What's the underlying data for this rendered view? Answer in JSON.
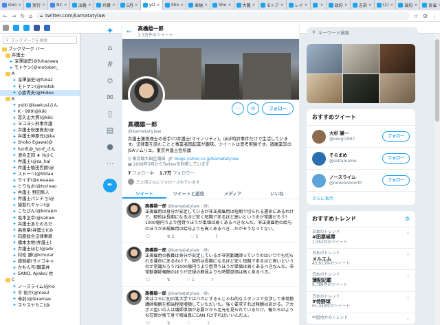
{
  "browser": {
    "tabs": [
      {
        "label": "Goo",
        "color": "#4285f4"
      },
      {
        "label": "実行",
        "color": "#1da1f2"
      },
      {
        "label": "NC",
        "color": "#4285f4"
      },
      {
        "label": "淡路",
        "color": "#1da1f2"
      },
      {
        "label": "弁護",
        "color": "#1da1f2"
      },
      {
        "label": "5月",
        "color": "#1da1f2"
      },
      {
        "label": "yst",
        "color": "#1da1f2"
      },
      {
        "label": "Sho",
        "color": "#1da1f2"
      },
      {
        "label": "奉納",
        "color": "#1da1f2"
      },
      {
        "label": "Sho",
        "color": "#1da1f2"
      },
      {
        "label": "大農",
        "color": "#1da1f2"
      },
      {
        "label": "モトア",
        "color": "#1da1f2"
      },
      {
        "label": "レイ",
        "color": "#1da1f2"
      },
      {
        "label": "",
        "color": "#1da1f2"
      },
      {
        "label": "政府",
        "color": "#1da1f2"
      },
      {
        "label": "吉梁",
        "color": "#1da1f2"
      },
      {
        "label": "(2)",
        "color": "#1da1f2"
      },
      {
        "label": "政府",
        "color": "#1da1f2"
      },
      {
        "label": "反省",
        "color": "#1da1f2"
      }
    ],
    "url": "twitter.com/kamatatylaw"
  },
  "sidebar": {
    "search_placeholder": "ブックマークを検索",
    "items": [
      {
        "label": "ブックマーク バー",
        "type": "folder",
        "indent": 0
      },
      {
        "label": "弁護士",
        "type": "folder",
        "indent": 1
      },
      {
        "label": "深澤諭史(@fukazawa",
        "type": "tw",
        "indent": 2
      },
      {
        "label": "モトケン(@motoken_",
        "type": "tw",
        "indent": 2
      },
      {
        "label": "A",
        "type": "folder",
        "indent": 1
      },
      {
        "label": "深澤諭史(@fukaz",
        "type": "tw",
        "indent": 3
      },
      {
        "label": "モトケン(@motok",
        "type": "tw",
        "indent": 3
      },
      {
        "label": "小倉秀夫(@Hideo",
        "type": "tw",
        "indent": 3,
        "selected": true
      },
      {
        "label": "B",
        "type": "folder",
        "indent": 1
      },
      {
        "label": "ystk(@lawkus)さん",
        "type": "tw",
        "indent": 3
      },
      {
        "label": "K・999(@kiki",
        "type": "tw",
        "indent": 3
      },
      {
        "label": "首久山大費(@kiki",
        "type": "tw",
        "indent": 3
      },
      {
        "label": "ヨコヨシ刑事弁護",
        "type": "tw",
        "indent": 3
      },
      {
        "label": "弁護士秋田真志(@",
        "type": "tw",
        "indent": 3
      },
      {
        "label": "弁護士神原元(@ka",
        "type": "tw",
        "indent": 3
      },
      {
        "label": "Shoko Egawa(@",
        "type": "tw",
        "indent": 3
      },
      {
        "label": "hznf(@_hznf_さん",
        "type": "tw",
        "indent": 3
      },
      {
        "label": "澄合正詞 ★ Yoji C",
        "type": "tw",
        "indent": 3
      },
      {
        "label": "弁護士(@sa_hal",
        "type": "tw",
        "indent": 3
      },
      {
        "label": "弁護士植田哲朗(@",
        "type": "tw",
        "indent": 3
      },
      {
        "label": "スドー☆(@Stdau",
        "type": "tw",
        "indent": 3
      },
      {
        "label": "サイボ(@uwaaaa",
        "type": "tw",
        "indent": 3
      },
      {
        "label": "とりなお(@torinao",
        "type": "tw",
        "indent": 3
      },
      {
        "label": "弁護士 野田隼人",
        "type": "tw",
        "indent": 3
      },
      {
        "label": "弁護士パンチョ(@",
        "type": "tw",
        "indent": 3
      },
      {
        "label": "猿割れギャン(@",
        "type": "tw",
        "indent": 3
      },
      {
        "label": "こたぴん(@kotapin",
        "type": "tw",
        "indent": 3
      },
      {
        "label": "坂本正幸(@sakaw",
        "type": "tw",
        "indent": 3
      },
      {
        "label": "弁護士あたのるだ",
        "type": "tw",
        "indent": 3
      },
      {
        "label": "高島章(弁護士)(@",
        "type": "tw",
        "indent": 3
      },
      {
        "label": "向原総合法律事務",
        "type": "tw",
        "indent": 3
      },
      {
        "label": "橋本太地(弁護士)",
        "type": "tw",
        "indent": 3
      },
      {
        "label": "弁護士ほむ(@adv",
        "type": "tw",
        "indent": 3
      },
      {
        "label": "村松 謙(@kmurar",
        "type": "tw",
        "indent": 3
      },
      {
        "label": "感熱紙(サイコキャ",
        "type": "tw",
        "indent": 3
      },
      {
        "label": "かもん弓(職業弁",
        "type": "tw",
        "indent": 3
      },
      {
        "label": "SANO, Ayako/ 佐",
        "type": "tw",
        "indent": 3
      },
      {
        "label": "C",
        "type": "folder",
        "indent": 1
      },
      {
        "label": "ノースライム(@no",
        "type": "tw",
        "indent": 3
      },
      {
        "label": "平 裕介(@Yusul",
        "type": "tw",
        "indent": 3
      },
      {
        "label": "寺前(@teramae",
        "type": "tw",
        "indent": 3
      },
      {
        "label": "スヤスヤちこ(@",
        "type": "tw",
        "indent": 3
      }
    ]
  },
  "leftnav": {
    "icons": [
      "home-icon",
      "explore-icon",
      "notifications-icon",
      "messages-icon",
      "bookmarks-icon",
      "lists-icon",
      "profile-icon",
      "more-icon"
    ]
  },
  "profile": {
    "header_name": "髙橋雄一郎",
    "header_tweets": "1.3万件のツイート",
    "name": "髙橋雄一郎",
    "handle": "@kamatatylaw",
    "follow_label": "フォロー",
    "bio": "弁護士兼税理士の若手(?)弁護士(マイノリティ)。ほぼ時評事件だけで生活しています。法律書を読むことと事業者国起業が趣味。ツイートは思考実験です。週履業営のJSAソムリエ。東京弁護士会所属",
    "location": "東京都大田区蒲田",
    "website": "blogs.yahoo.co.jp/kamatatylaw",
    "joined": "2009年3月からTwitterを利用しています",
    "following_count": "7",
    "following_label": "フォロー中",
    "followers_count": "1.7万",
    "followers_label": "フォロワー",
    "followed_by": "三上淳さんにフォローされています"
  },
  "tabs": [
    "ツイート",
    "ツイートと返信",
    "メディア",
    "いいね"
  ],
  "tweets": [
    {
      "name": "髙橋雄一郎",
      "handle": "@kamatatylaw",
      "time": "6h",
      "text": "正規雇用は身分が安定しているが非正規雇用は短期で切られる運命にあるわけで、契約は長期になるほど安く短期であるほど高いというのが常識だろう?1000億円うより借貸うほうが単価は高くあるべきなんだ。非正規雇用の給与のほうが正規雇用の給与よりも高くあるべき…だがそうなってない。",
      "reply": "",
      "retweet": "2",
      "like": "5"
    },
    {
      "name": "髙橋雄一郎",
      "handle": "@kamatatylaw",
      "time": "6h",
      "text": "正規雇用の教員は身分が安定しているが非常勤講師っていうのはいつでも切られる運命にあるわけで、契約は長期になるほど安く短期であるほど高いというのが常識だろう?1000億円うより借貸うほうが単価は高くあるべきなんだ。非常勤講師報酬のほうが正規の教員よりも時間単価は高くあるべき。",
      "reply": "",
      "retweet": "",
      "like": "1"
    },
    {
      "name": "髙橋雄一郎",
      "handle": "@kamatatylaw",
      "time": "6h",
      "text": "実はさらに別の某大学ではバカにするんじゃね的なスタンスで交渉して非常勤講師報酬を相当程度増額していただいた。強く要求すれば報酬はあがる。アカポス狙いの人は講師単価が必要だから足元を見られているだけ。俺たちのような在野が捨て身で相当真にCAN FLYすればいいんだよ。",
      "reply": "",
      "retweet": "",
      "like": ""
    }
  ],
  "right": {
    "search_placeholder": "キーワード検索",
    "recommend_title": "おすすめツイート",
    "suggestions": [
      {
        "name": "大杉 謙一",
        "handle": "@osugi1967",
        "button": "フォロー",
        "color": "#8c6a4f"
      },
      {
        "name": "そらまめ",
        "handle": "@soltamame",
        "button": "フォロー",
        "color": "#2c6fb0"
      },
      {
        "name": "ノースライム",
        "handle": "@noooooooorth",
        "button": "フォロー",
        "color": "#5ba3d8"
      }
    ],
    "more_label": "さらに表示",
    "trends_title": "おすすめトレンド",
    "trends": [
      {
        "context": "日本のトレンド",
        "tag": "#田票候章",
        "count": "1,352件のツイート"
      },
      {
        "context": "日本のトレンド",
        "tag": "メルエム",
        "count": "43,913件のツイート"
      },
      {
        "context": "日本のトレンド",
        "tag": "薄配記載",
        "count": "8,788件のツイート"
      },
      {
        "context": "日本のトレンド",
        "tag": "#侍野球",
        "count": "61,344件のツイート"
      },
      {
        "context": "中国地方のトレンド",
        "tag": "",
        "count": ""
      }
    ]
  }
}
